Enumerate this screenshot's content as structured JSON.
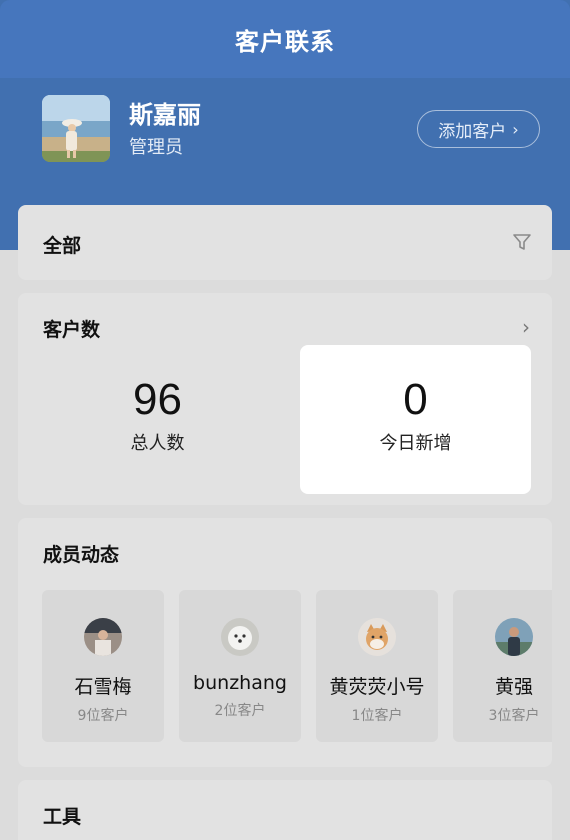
{
  "header": {
    "title": "客户联系"
  },
  "profile": {
    "name": "斯嘉丽",
    "role": "管理员",
    "add_button": "添加客户",
    "add_chevron": "›"
  },
  "filter": {
    "label": "全部",
    "icon": "filter-icon"
  },
  "customer_count": {
    "label": "客户数",
    "chevron": "›",
    "total": {
      "value": "96",
      "caption": "总人数"
    },
    "today": {
      "value": "0",
      "caption": "今日新增"
    }
  },
  "members": {
    "label": "成员动态",
    "items": [
      {
        "name": "石雪梅",
        "customers": "9位客户"
      },
      {
        "name": "bunzhang",
        "customers": "2位客户"
      },
      {
        "name": "黄荧荧小号",
        "customers": "1位客户"
      },
      {
        "name": "黄强",
        "customers": "3位客户"
      }
    ]
  },
  "tools": {
    "label": "工具"
  },
  "colors": {
    "header_blue": "#4676bd",
    "profile_blue": "#4170b0",
    "card_bg": "#e2e2e2"
  }
}
